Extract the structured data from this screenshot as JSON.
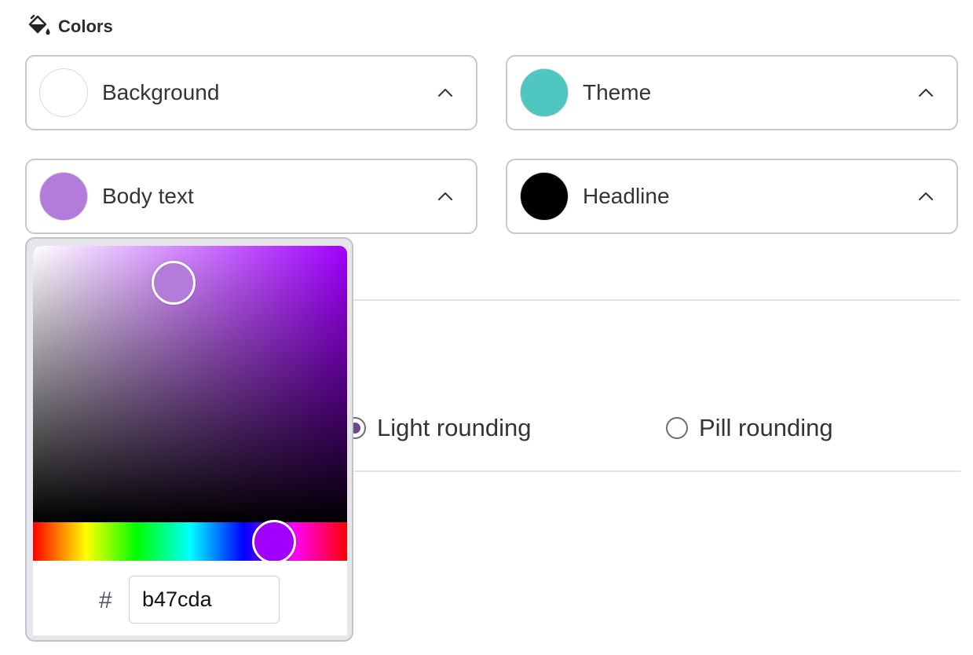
{
  "section": {
    "title": "Colors",
    "icon": "paint-bucket-icon"
  },
  "colors": {
    "background": {
      "label": "Background",
      "swatch": "#ffffff"
    },
    "theme": {
      "label": "Theme",
      "swatch": "#4fc6bf"
    },
    "body_text": {
      "label": "Body text",
      "swatch": "#b47cda"
    },
    "headline": {
      "label": "Headline",
      "swatch": "#000000"
    }
  },
  "rounding": {
    "options": [
      {
        "label": "Light rounding",
        "selected": true
      },
      {
        "label": "Pill rounding",
        "selected": false
      }
    ]
  },
  "picker": {
    "hash": "#",
    "hex_value": "b47cda",
    "selected_color": "#b47cda",
    "hue_color": "#a100ff"
  }
}
